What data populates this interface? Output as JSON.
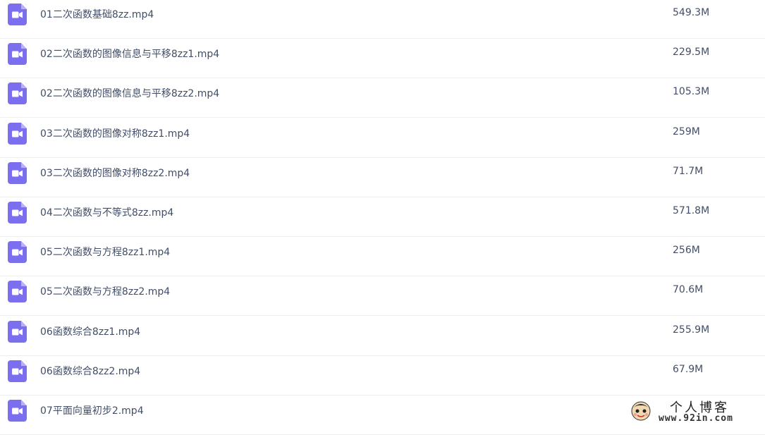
{
  "files": [
    {
      "name": "01二次函数基础8zz.mp4",
      "size": "549.3M",
      "icon": "video-file-icon"
    },
    {
      "name": "02二次函数的图像信息与平移8zz1.mp4",
      "size": "229.5M",
      "icon": "video-file-icon"
    },
    {
      "name": "02二次函数的图像信息与平移8zz2.mp4",
      "size": "105.3M",
      "icon": "video-file-icon"
    },
    {
      "name": "03二次函数的图像对称8zz1.mp4",
      "size": "259M",
      "icon": "video-file-icon"
    },
    {
      "name": "03二次函数的图像对称8zz2.mp4",
      "size": "71.7M",
      "icon": "video-file-icon"
    },
    {
      "name": "04二次函数与不等式8zz.mp4",
      "size": "571.8M",
      "icon": "video-file-icon"
    },
    {
      "name": "05二次函数与方程8zz1.mp4",
      "size": "256M",
      "icon": "video-file-icon"
    },
    {
      "name": "05二次函数与方程8zz2.mp4",
      "size": "70.6M",
      "icon": "video-file-icon"
    },
    {
      "name": "06函数综合8zz1.mp4",
      "size": "255.9M",
      "icon": "video-file-icon"
    },
    {
      "name": "06函数综合8zz2.mp4",
      "size": "67.9M",
      "icon": "video-file-icon"
    },
    {
      "name": "07平面向量初步2.mp4",
      "size": "",
      "icon": "video-file-icon"
    }
  ],
  "watermark": {
    "title": "个人博客",
    "url": "www.92in.com"
  },
  "colors": {
    "icon": "#7b6ff0",
    "text": "#424e67",
    "divider": "#eeeeee"
  }
}
